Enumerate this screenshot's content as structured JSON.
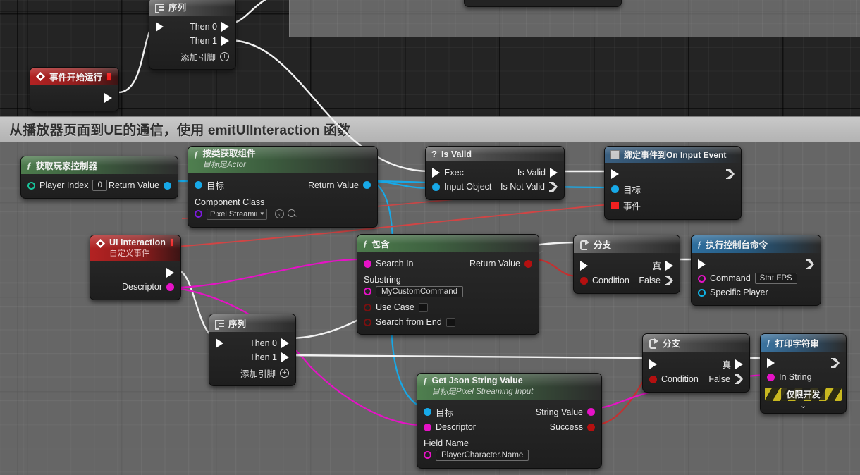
{
  "comment": {
    "title": "从播放器页面到UE的通信，使用 emitUIInteraction 函数"
  },
  "nodes": {
    "event_begin_play": {
      "title": "事件开始运行",
      "icon": "event-diamond-icon",
      "out_exec": ""
    },
    "sequence_top": {
      "title": "序列",
      "icon": "sequence-icon",
      "then0": "Then 0",
      "then1": "Then 1",
      "add_pin": "添加引脚"
    },
    "get_player_controller": {
      "title": "获取玩家控制器",
      "player_index_label": "Player Index",
      "player_index_value": "0",
      "return_value": "Return Value"
    },
    "get_component_by_class": {
      "title": "按类获取组件",
      "subtitle": "目标是Actor",
      "target": "目标",
      "return_value": "Return Value",
      "component_class_label": "Component Class",
      "component_class_value": "Pixel Streaming"
    },
    "is_valid": {
      "title": "Is Valid",
      "icon": "question-mark-icon",
      "exec": "Exec",
      "input_object": "Input Object",
      "is_valid": "Is Valid",
      "is_not_valid": "Is Not Valid"
    },
    "bind_event": {
      "title": "绑定事件到On Input Event",
      "icon": "bind-event-icon",
      "target": "目标",
      "event": "事件"
    },
    "ui_interaction": {
      "title": "UI Interaction",
      "subtitle": "自定义事件",
      "descriptor": "Descriptor"
    },
    "contains": {
      "title": "包含",
      "search_in": "Search In",
      "return_value": "Return Value",
      "substring_label": "Substring",
      "substring_value": "MyCustomCommand",
      "use_case": "Use Case",
      "search_from_end": "Search from End"
    },
    "branch_top": {
      "title": "分支",
      "condition": "Condition",
      "true_label": "真",
      "false_label": "False"
    },
    "execute_console_command": {
      "title": "执行控制台命令",
      "command_label": "Command",
      "command_value": "Stat FPS",
      "specific_player": "Specific Player"
    },
    "sequence_mid": {
      "title": "序列",
      "icon": "sequence-icon",
      "then0": "Then 0",
      "then1": "Then 1",
      "add_pin": "添加引脚"
    },
    "get_json_string_value": {
      "title": "Get Json String Value",
      "subtitle": "目标是Pixel Streaming Input",
      "target": "目标",
      "descriptor": "Descriptor",
      "string_value": "String Value",
      "success": "Success",
      "field_name_label": "Field Name",
      "field_name_value": "PlayerCharacter.Name"
    },
    "branch_bottom": {
      "title": "分支",
      "condition": "Condition",
      "true_label": "真",
      "false_label": "False"
    },
    "print_string": {
      "title": "打印字符串",
      "in_string": "In String",
      "dev_only": "仅限开发"
    }
  },
  "colors": {
    "exec_wire": "#f2f2f2",
    "object_wire": "#17a9e8",
    "bool_wire": "#c53030",
    "string_wire": "#e612c6",
    "function_header": "#4c7b4c",
    "event_header": "#b32222",
    "console_header": "#2d6e9e"
  }
}
